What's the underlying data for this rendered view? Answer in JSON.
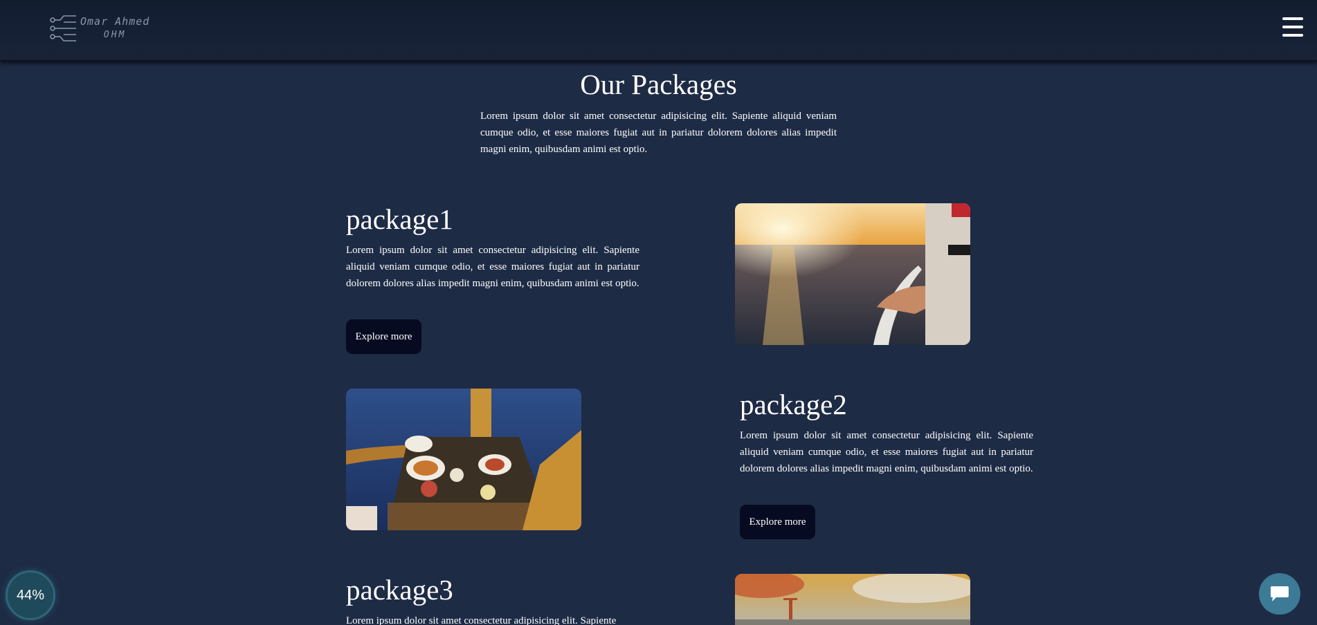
{
  "header": {
    "logo": {
      "name_line": "Omar Ahmed",
      "initials": "OHM"
    },
    "menu_icon": "hamburger-menu-icon"
  },
  "section": {
    "title": "Our Packages",
    "description": "Lorem ipsum dolor sit amet consectetur adipisicing elit. Sapiente aliquid veniam cumque odio, et esse maiores fugiat aut in pariatur dolorem dolores alias impedit magni enim, quibusdam animi est optio."
  },
  "packages": [
    {
      "title": "package1",
      "description": "Lorem ipsum dolor sit amet consectetur adipisicing elit. Sapiente aliquid veniam cumque odio, et esse maiores fugiat aut in pariatur dolorem dolores alias impedit magni enim, quibusdam animi est optio.",
      "button_label": "Explore more",
      "image": "sunset-sea-cruise-railing-photo"
    },
    {
      "title": "package2",
      "description": "Lorem ipsum dolor sit amet consectetur adipisicing elit. Sapiente aliquid veniam cumque odio, et esse maiores fugiat aut in pariatur dolorem dolores alias impedit magni enim, quibusdam animi est optio.",
      "button_label": "Explore more",
      "image": "breakfast-table-on-deck-photo"
    },
    {
      "title": "package3",
      "description": "Lorem ipsum dolor sit amet consectetur adipisicing elit. Sapiente",
      "image": "ship-deck-sunset-photo"
    }
  ],
  "widgets": {
    "progress_label": "44%",
    "progress_fraction": 0.44,
    "chat_icon": "chat-bubble-icon"
  },
  "colors": {
    "background": "#1e2b45",
    "header": "#141f33",
    "button": "#070b22",
    "chat_widget": "#3c7a95"
  }
}
